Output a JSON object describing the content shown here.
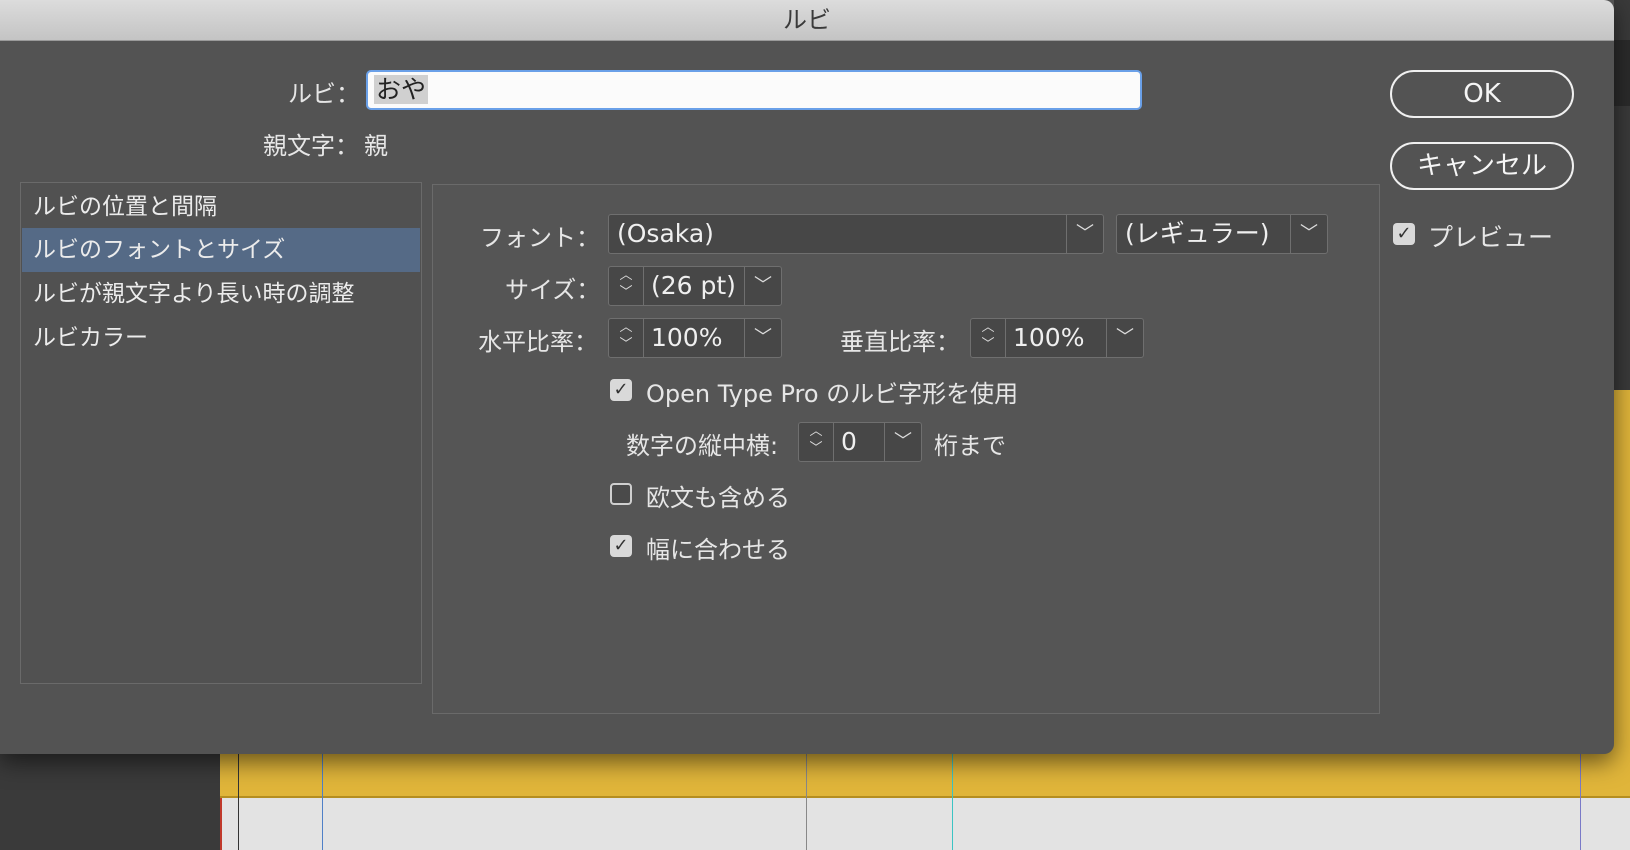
{
  "window": {
    "title": "ルビ"
  },
  "ruby": {
    "label": "ルビ：",
    "value": "おや"
  },
  "base_text": {
    "label": "親文字：",
    "value": "親"
  },
  "buttons": {
    "ok": "OK",
    "cancel": "キャンセル"
  },
  "preview": {
    "label": "プレビュー",
    "checked": true
  },
  "sidebar": {
    "items": [
      {
        "label": "ルビの位置と間隔",
        "active": false
      },
      {
        "label": "ルビのフォントとサイズ",
        "active": true
      },
      {
        "label": "ルビが親文字より長い時の調整",
        "active": false
      },
      {
        "label": "ルビカラー",
        "active": false
      }
    ]
  },
  "font": {
    "label": "フォント：",
    "family": "(Osaka)",
    "style": "(レギュラー)"
  },
  "size": {
    "label": "サイズ：",
    "value": "(26 pt)"
  },
  "h_scale": {
    "label": "水平比率：",
    "value": "100%"
  },
  "v_scale": {
    "label": "垂直比率：",
    "value": "100%"
  },
  "opentype": {
    "label": "Open Type Pro のルビ字形を使用",
    "checked": true
  },
  "tate_chu_yoko": {
    "label": "数字の縦中横:",
    "value": "0",
    "suffix": "桁まで"
  },
  "include_roman": {
    "label": "欧文も含める",
    "checked": false
  },
  "fit_width": {
    "label": "幅に合わせる",
    "checked": true
  },
  "colors": {
    "selected_item": "#556a86",
    "focus_ring": "#6aa0e8",
    "document_highlight": "#e0b53a"
  }
}
